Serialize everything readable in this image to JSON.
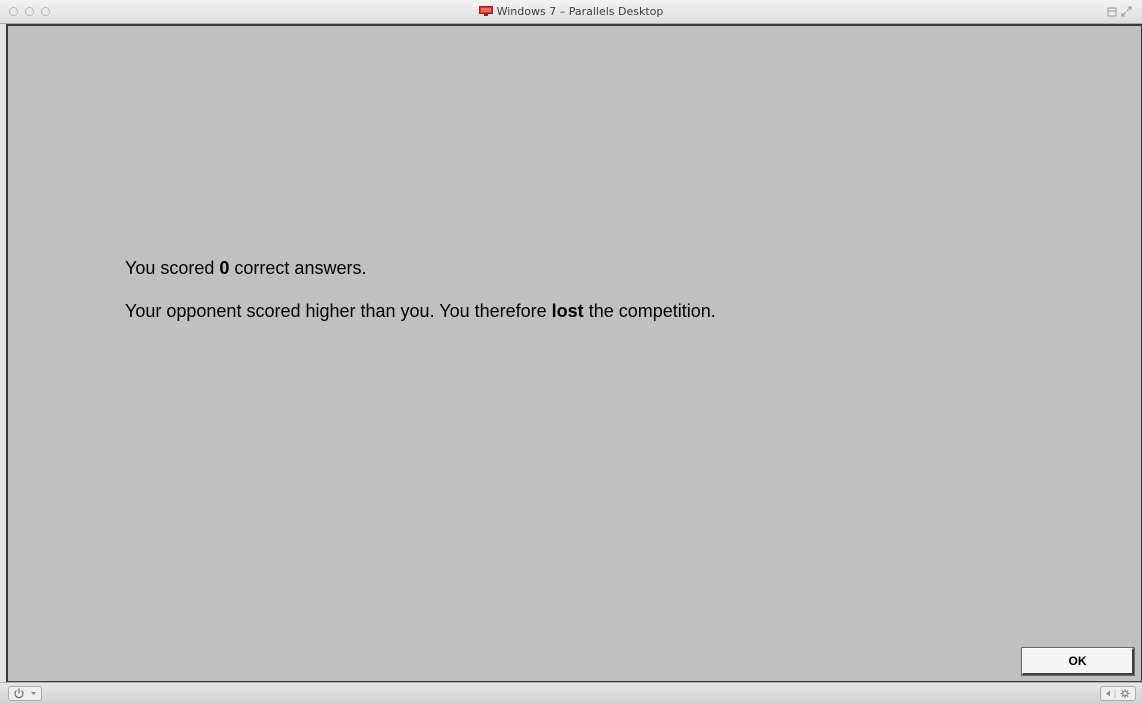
{
  "window": {
    "title": "Windows 7 – Parallels Desktop",
    "title_icon": "parallels-monitor-icon"
  },
  "screen": {
    "background": "#c0c0c0",
    "line1": {
      "prefix": "You scored ",
      "score": "0",
      "suffix": " correct answers."
    },
    "line2": {
      "prefix": "Your opponent scored higher than you. You therefore ",
      "outcome": "lost",
      "suffix": " the competition."
    },
    "ok_label": "OK"
  },
  "statusbar": {
    "power_icon": "power-icon",
    "right_icons": [
      "sound-icon",
      "settings-gear-icon"
    ]
  },
  "colors": {
    "title_icon": "#d9342b",
    "screen_bg": "#c0c0c0"
  }
}
